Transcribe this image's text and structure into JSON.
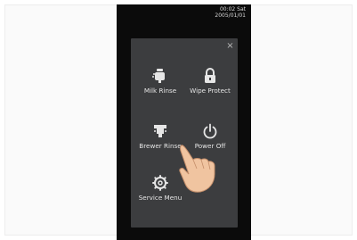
{
  "status": {
    "time_day": "00:02 Sat",
    "date": "2005/01/01"
  },
  "menu": {
    "items": [
      {
        "label": "Milk Rinse",
        "icon": "milk-rinse-icon"
      },
      {
        "label": "Wipe Protect",
        "icon": "lock-icon"
      },
      {
        "label": "Brewer Rinse",
        "icon": "brewer-rinse-icon"
      },
      {
        "label": "Power Off",
        "icon": "power-icon"
      },
      {
        "label": "Service Menu",
        "icon": "gear-icon"
      }
    ]
  },
  "colors": {
    "panel": "#3c3d3f",
    "device": "#0b0b0b",
    "text": "#e6e6e6"
  }
}
